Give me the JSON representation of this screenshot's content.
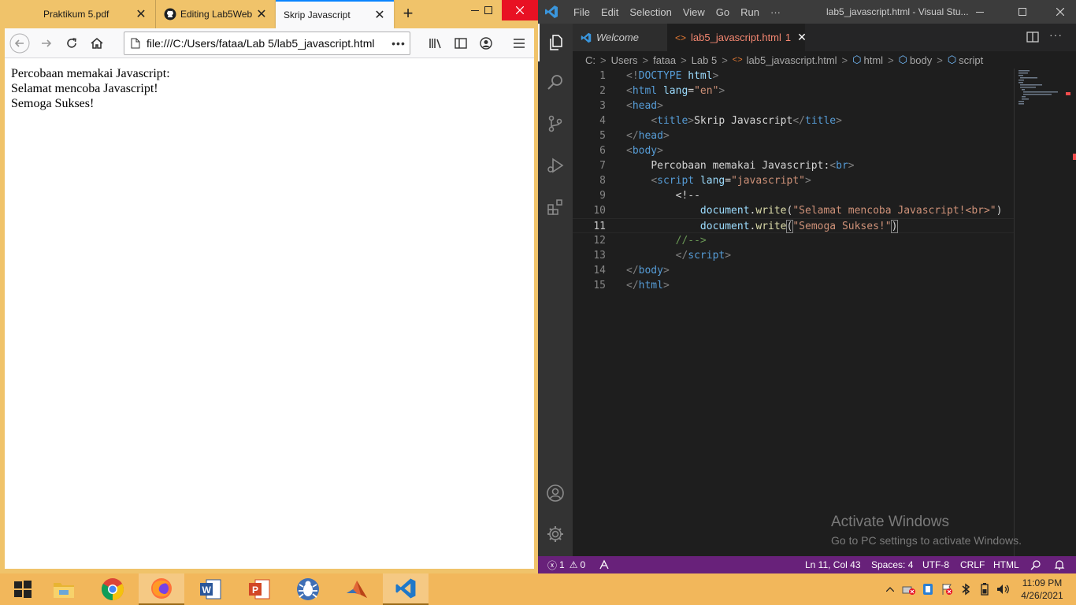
{
  "firefox": {
    "tabs": [
      {
        "label": "Praktikum 5.pdf",
        "icon": "pdf-icon",
        "active": false
      },
      {
        "label": "Editing Lab5Web",
        "icon": "github-icon",
        "active": false
      },
      {
        "label": "Skrip Javascript",
        "icon": "",
        "active": true
      }
    ],
    "url": "file:///C:/Users/fataa/Lab 5/lab5_javascript.html",
    "page_lines": [
      "Percobaan memakai Javascript:",
      "Selamat mencoba Javascript!",
      "Semoga Sukses!"
    ]
  },
  "vscode": {
    "menu": [
      "File",
      "Edit",
      "Selection",
      "View",
      "Go",
      "Run",
      "···"
    ],
    "window_title": "lab5_javascript.html - Visual Stu...",
    "tabs": {
      "welcome": "Welcome",
      "file": "lab5_javascript.html",
      "file_problems": "1"
    },
    "breadcrumb": [
      "C:",
      "Users",
      "fataa",
      "Lab 5",
      "lab5_javascript.html",
      "html",
      "body",
      "script"
    ],
    "line_numbers": [
      "1",
      "2",
      "3",
      "4",
      "5",
      "6",
      "7",
      "8",
      "9",
      "10",
      "11",
      "12",
      "13",
      "14",
      "15"
    ],
    "current_line": 11,
    "activate": {
      "title": "Activate Windows",
      "subtitle": "Go to PC settings to activate Windows."
    },
    "status": {
      "errors": "1",
      "warnings": "0",
      "cursor": "Ln 11, Col 43",
      "spaces": "Spaces: 4",
      "encoding": "UTF-8",
      "eol": "CRLF",
      "language": "HTML"
    },
    "colors": {
      "status_bar": "#68217a",
      "activity_bar": "#333333",
      "editor": "#1e1e1e"
    }
  },
  "taskbar": {
    "apps": [
      "file-explorer-icon",
      "chrome-icon",
      "firefox-icon",
      "word-icon",
      "powerpoint-icon",
      "bug-app-icon",
      "matlab-icon",
      "vscode-icon"
    ],
    "time": "11:09 PM",
    "date": "4/26/2021"
  }
}
